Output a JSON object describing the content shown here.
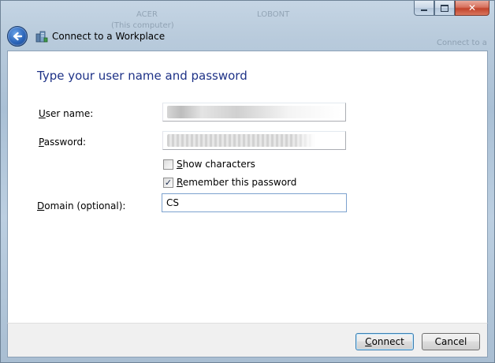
{
  "window": {
    "caption_buttons": {
      "minimize_icon": "minimize-icon",
      "maximize_icon": "maximize-icon",
      "close_icon": "close-icon",
      "close_glyph": "✕"
    }
  },
  "background_ghost": [
    "ACER",
    "LOBONT",
    "(This computer)",
    "Connect to a"
  ],
  "nav": {
    "back_icon": "back-arrow-icon",
    "title_icon": "workplace-network-icon",
    "title": "Connect to a Workplace"
  },
  "form": {
    "heading": "Type your user name and password",
    "username": {
      "label_pre": "",
      "label_accel": "U",
      "label_post": "ser name:",
      "value": ""
    },
    "password": {
      "label_pre": "",
      "label_accel": "P",
      "label_post": "assword:",
      "value": ""
    },
    "show_characters": {
      "label_pre": "",
      "label_accel": "S",
      "label_post": "how characters",
      "checked": false
    },
    "remember_password": {
      "label_pre": "",
      "label_accel": "R",
      "label_post": "emember this password",
      "checked": true,
      "check_glyph": "✓"
    },
    "domain": {
      "label_pre": "",
      "label_accel": "D",
      "label_post": "omain (optional):",
      "value": "CS"
    }
  },
  "footer": {
    "connect": {
      "label_pre": "",
      "label_accel": "C",
      "label_post": "onnect"
    },
    "cancel": {
      "label": "Cancel"
    }
  },
  "colors": {
    "heading": "#1e3287",
    "default_button_border": "#3c7fb1",
    "close_button": "#c2432b"
  }
}
